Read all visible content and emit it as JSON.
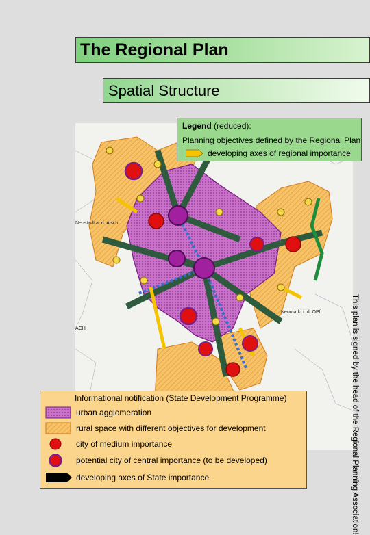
{
  "header": {
    "title": "The Regional Plan"
  },
  "section": {
    "subtitle": "Spatial Structure"
  },
  "legend_top": {
    "title_bold": "Legend",
    "title_rest": " (reduced):",
    "subtitle": "Planning objectives defined by the Regional Plan",
    "items": [
      {
        "label": "developing axes of regional importance",
        "icon": "axis-arrow-icon",
        "color": "#f5c400"
      }
    ]
  },
  "legend_bottom": {
    "title": "Informational notification (State Development Programme)",
    "items": [
      {
        "label": "urban agglomeration",
        "icon": "urban-agglomeration-swatch",
        "color": "#c66bc8"
      },
      {
        "label": "rural space with different objectives for development",
        "icon": "rural-space-swatch",
        "color": "#f5b54a"
      },
      {
        "label": "city of medium importance",
        "icon": "medium-city-icon",
        "color": "#e01010"
      },
      {
        "label": "potential city of central importance (to be developed)",
        "icon": "potential-central-city-icon",
        "color": "#e01010"
      },
      {
        "label": "developing axes of State importance",
        "icon": "state-axis-arrow-icon",
        "color": "#000000"
      }
    ]
  },
  "side_note": "This plan is signed by the head of the Regional Planning Association!",
  "map_labels": {
    "place_right": "Neumarkt i. d. OPf.",
    "place_left_top": "Neustadt a. d. Aisch",
    "place_left_bottom": "ACH"
  },
  "colors": {
    "urban": "#c66bc8",
    "urban_dark": "#9c3aa6",
    "rural": "#f5b54a",
    "rural_light": "#f9d98a",
    "axis_state": "#2e5b3e",
    "axis_regional": "#f5c400",
    "city": "#e01010",
    "central": "#a020a0"
  }
}
